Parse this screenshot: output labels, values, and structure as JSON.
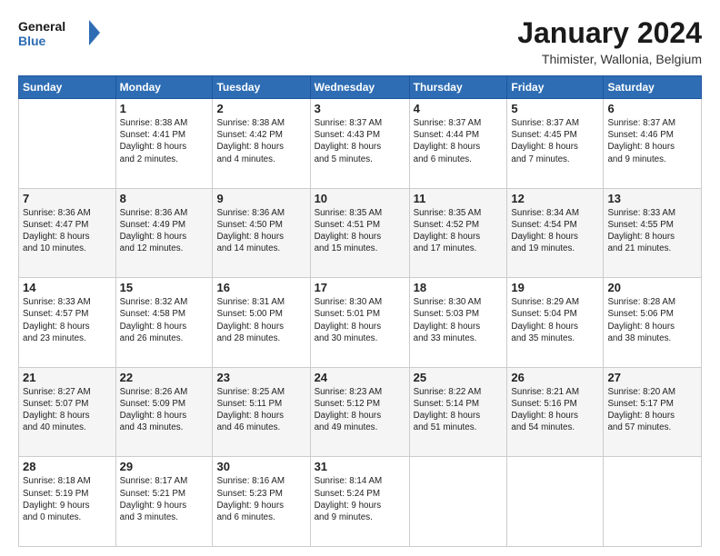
{
  "header": {
    "logo_line1": "General",
    "logo_line2": "Blue",
    "month": "January 2024",
    "location": "Thimister, Wallonia, Belgium"
  },
  "days_of_week": [
    "Sunday",
    "Monday",
    "Tuesday",
    "Wednesday",
    "Thursday",
    "Friday",
    "Saturday"
  ],
  "weeks": [
    [
      {
        "num": "",
        "info": ""
      },
      {
        "num": "1",
        "info": "Sunrise: 8:38 AM\nSunset: 4:41 PM\nDaylight: 8 hours\nand 2 minutes."
      },
      {
        "num": "2",
        "info": "Sunrise: 8:38 AM\nSunset: 4:42 PM\nDaylight: 8 hours\nand 4 minutes."
      },
      {
        "num": "3",
        "info": "Sunrise: 8:37 AM\nSunset: 4:43 PM\nDaylight: 8 hours\nand 5 minutes."
      },
      {
        "num": "4",
        "info": "Sunrise: 8:37 AM\nSunset: 4:44 PM\nDaylight: 8 hours\nand 6 minutes."
      },
      {
        "num": "5",
        "info": "Sunrise: 8:37 AM\nSunset: 4:45 PM\nDaylight: 8 hours\nand 7 minutes."
      },
      {
        "num": "6",
        "info": "Sunrise: 8:37 AM\nSunset: 4:46 PM\nDaylight: 8 hours\nand 9 minutes."
      }
    ],
    [
      {
        "num": "7",
        "info": "Sunrise: 8:36 AM\nSunset: 4:47 PM\nDaylight: 8 hours\nand 10 minutes."
      },
      {
        "num": "8",
        "info": "Sunrise: 8:36 AM\nSunset: 4:49 PM\nDaylight: 8 hours\nand 12 minutes."
      },
      {
        "num": "9",
        "info": "Sunrise: 8:36 AM\nSunset: 4:50 PM\nDaylight: 8 hours\nand 14 minutes."
      },
      {
        "num": "10",
        "info": "Sunrise: 8:35 AM\nSunset: 4:51 PM\nDaylight: 8 hours\nand 15 minutes."
      },
      {
        "num": "11",
        "info": "Sunrise: 8:35 AM\nSunset: 4:52 PM\nDaylight: 8 hours\nand 17 minutes."
      },
      {
        "num": "12",
        "info": "Sunrise: 8:34 AM\nSunset: 4:54 PM\nDaylight: 8 hours\nand 19 minutes."
      },
      {
        "num": "13",
        "info": "Sunrise: 8:33 AM\nSunset: 4:55 PM\nDaylight: 8 hours\nand 21 minutes."
      }
    ],
    [
      {
        "num": "14",
        "info": "Sunrise: 8:33 AM\nSunset: 4:57 PM\nDaylight: 8 hours\nand 23 minutes."
      },
      {
        "num": "15",
        "info": "Sunrise: 8:32 AM\nSunset: 4:58 PM\nDaylight: 8 hours\nand 26 minutes."
      },
      {
        "num": "16",
        "info": "Sunrise: 8:31 AM\nSunset: 5:00 PM\nDaylight: 8 hours\nand 28 minutes."
      },
      {
        "num": "17",
        "info": "Sunrise: 8:30 AM\nSunset: 5:01 PM\nDaylight: 8 hours\nand 30 minutes."
      },
      {
        "num": "18",
        "info": "Sunrise: 8:30 AM\nSunset: 5:03 PM\nDaylight: 8 hours\nand 33 minutes."
      },
      {
        "num": "19",
        "info": "Sunrise: 8:29 AM\nSunset: 5:04 PM\nDaylight: 8 hours\nand 35 minutes."
      },
      {
        "num": "20",
        "info": "Sunrise: 8:28 AM\nSunset: 5:06 PM\nDaylight: 8 hours\nand 38 minutes."
      }
    ],
    [
      {
        "num": "21",
        "info": "Sunrise: 8:27 AM\nSunset: 5:07 PM\nDaylight: 8 hours\nand 40 minutes."
      },
      {
        "num": "22",
        "info": "Sunrise: 8:26 AM\nSunset: 5:09 PM\nDaylight: 8 hours\nand 43 minutes."
      },
      {
        "num": "23",
        "info": "Sunrise: 8:25 AM\nSunset: 5:11 PM\nDaylight: 8 hours\nand 46 minutes."
      },
      {
        "num": "24",
        "info": "Sunrise: 8:23 AM\nSunset: 5:12 PM\nDaylight: 8 hours\nand 49 minutes."
      },
      {
        "num": "25",
        "info": "Sunrise: 8:22 AM\nSunset: 5:14 PM\nDaylight: 8 hours\nand 51 minutes."
      },
      {
        "num": "26",
        "info": "Sunrise: 8:21 AM\nSunset: 5:16 PM\nDaylight: 8 hours\nand 54 minutes."
      },
      {
        "num": "27",
        "info": "Sunrise: 8:20 AM\nSunset: 5:17 PM\nDaylight: 8 hours\nand 57 minutes."
      }
    ],
    [
      {
        "num": "28",
        "info": "Sunrise: 8:18 AM\nSunset: 5:19 PM\nDaylight: 9 hours\nand 0 minutes."
      },
      {
        "num": "29",
        "info": "Sunrise: 8:17 AM\nSunset: 5:21 PM\nDaylight: 9 hours\nand 3 minutes."
      },
      {
        "num": "30",
        "info": "Sunrise: 8:16 AM\nSunset: 5:23 PM\nDaylight: 9 hours\nand 6 minutes."
      },
      {
        "num": "31",
        "info": "Sunrise: 8:14 AM\nSunset: 5:24 PM\nDaylight: 9 hours\nand 9 minutes."
      },
      {
        "num": "",
        "info": ""
      },
      {
        "num": "",
        "info": ""
      },
      {
        "num": "",
        "info": ""
      }
    ]
  ]
}
